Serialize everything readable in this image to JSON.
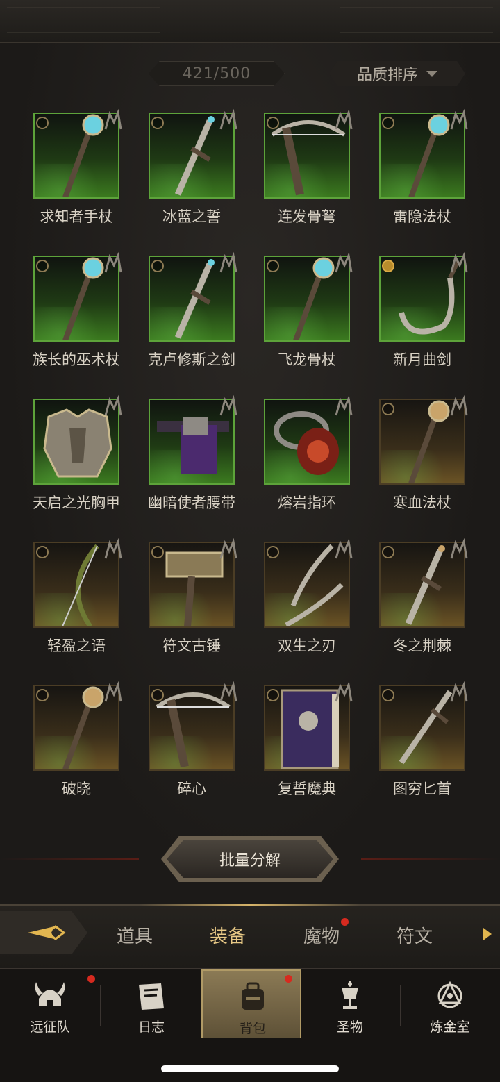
{
  "inventory": {
    "count": "421/500",
    "sort_label": "品质排序"
  },
  "items": [
    {
      "name": "求知者手杖",
      "rarity": "green",
      "lock": "ring"
    },
    {
      "name": "冰蓝之誓",
      "rarity": "green",
      "lock": "ring"
    },
    {
      "name": "连发骨弩",
      "rarity": "green",
      "lock": "ring"
    },
    {
      "name": "雷隐法杖",
      "rarity": "green",
      "lock": "ring"
    },
    {
      "name": "族长的巫术杖",
      "rarity": "green",
      "lock": "ring"
    },
    {
      "name": "克卢修斯之剑",
      "rarity": "green",
      "lock": "ring"
    },
    {
      "name": "飞龙骨杖",
      "rarity": "green",
      "lock": "ring"
    },
    {
      "name": "新月曲剑",
      "rarity": "green",
      "lock": "gold"
    },
    {
      "name": "天启之光胸甲",
      "rarity": "green",
      "lock": "none"
    },
    {
      "name": "幽暗使者腰带",
      "rarity": "green",
      "lock": "none"
    },
    {
      "name": "熔岩指环",
      "rarity": "green",
      "lock": "none"
    },
    {
      "name": "寒血法杖",
      "rarity": "gold",
      "lock": "ring"
    },
    {
      "name": "轻盈之语",
      "rarity": "gold",
      "lock": "ring"
    },
    {
      "name": "符文古锤",
      "rarity": "gold",
      "lock": "ring"
    },
    {
      "name": "双生之刃",
      "rarity": "gold",
      "lock": "ring"
    },
    {
      "name": "冬之荆棘",
      "rarity": "gold",
      "lock": "ring"
    },
    {
      "name": "破晓",
      "rarity": "gold",
      "lock": "ring"
    },
    {
      "name": "碎心",
      "rarity": "gold",
      "lock": "ring"
    },
    {
      "name": "复誓魔典",
      "rarity": "gold",
      "lock": "ring"
    },
    {
      "name": "图穷匕首",
      "rarity": "gold",
      "lock": "ring"
    }
  ],
  "batch_button": "批量分解",
  "tabs": [
    {
      "label": "道具",
      "active": false,
      "dot": false
    },
    {
      "label": "装备",
      "active": true,
      "dot": false
    },
    {
      "label": "魔物",
      "active": false,
      "dot": true
    },
    {
      "label": "符文",
      "active": false,
      "dot": false
    }
  ],
  "nav": [
    {
      "label": "远征队",
      "icon": "viking-helmet-icon",
      "dot": true
    },
    {
      "label": "日志",
      "icon": "scroll-icon",
      "dot": false
    },
    {
      "label": "背包",
      "icon": "backpack-icon",
      "dot": true
    },
    {
      "label": "圣物",
      "icon": "chalice-icon",
      "dot": false
    },
    {
      "label": "炼金室",
      "icon": "alchemy-icon",
      "dot": false
    }
  ],
  "colors": {
    "rare_green": "#5da33a",
    "accent_gold": "#e8c986",
    "notify_red": "#d62a1f"
  }
}
